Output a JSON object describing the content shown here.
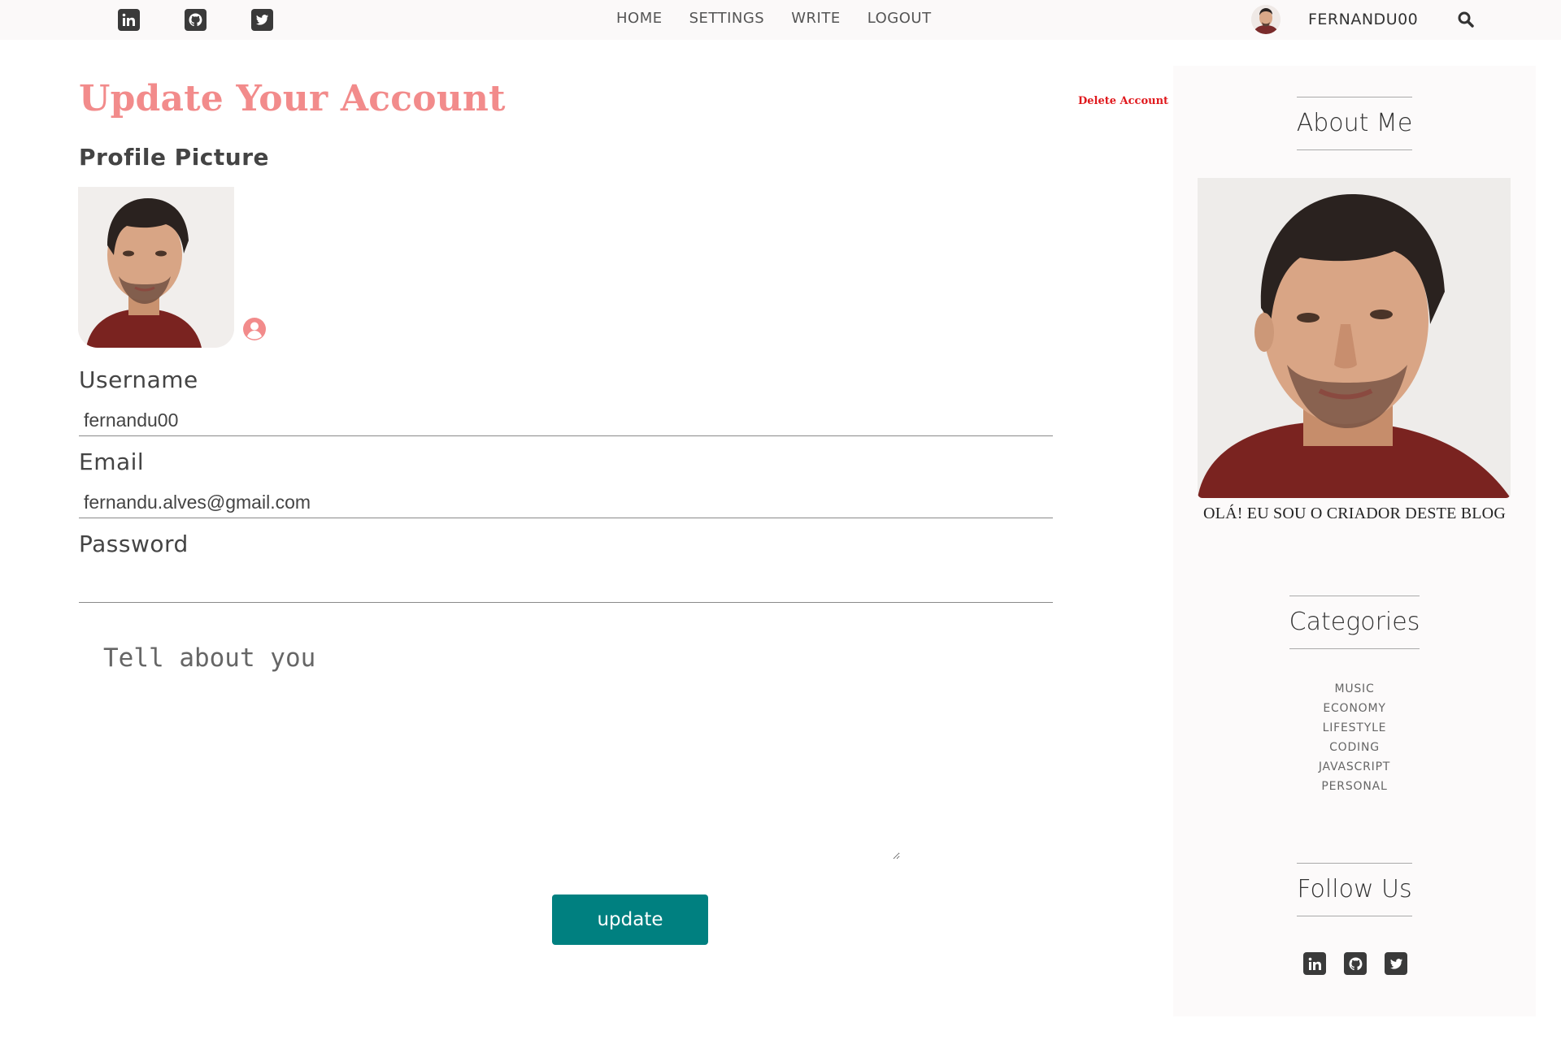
{
  "nav": {
    "social": [
      "linkedin-icon",
      "github-icon",
      "twitter-icon"
    ],
    "menu": [
      "HOME",
      "SETTINGS",
      "WRITE",
      "LOGOUT"
    ],
    "username": "FERNANDU00"
  },
  "main": {
    "title": "Update Your Account",
    "delete_label": "Delete Account",
    "profile_picture_label": "Profile Picture",
    "username_label": "Username",
    "username_value": "fernandu00",
    "email_label": "Email",
    "email_value": "fernandu.alves@gmail.com",
    "password_label": "Password",
    "password_value": "",
    "bio_placeholder": "Tell about you",
    "update_label": "update"
  },
  "sidebar": {
    "about_title": "About Me",
    "about_text": "OLÁ! EU SOU O CRIADOR DESTE BLOG",
    "categories_title": "Categories",
    "categories": [
      "MUSIC",
      "ECONOMY",
      "LIFESTYLE",
      "CODING",
      "JAVASCRIPT",
      "PERSONAL"
    ],
    "follow_title": "Follow Us",
    "social": [
      "linkedin-icon",
      "github-icon",
      "twitter-icon"
    ]
  },
  "colors": {
    "title": "#f28b8b",
    "delete": "#e0191d",
    "button": "#008080",
    "topbar_bg": "#fbf9f9",
    "sidebar_bg": "#fcfafa"
  }
}
